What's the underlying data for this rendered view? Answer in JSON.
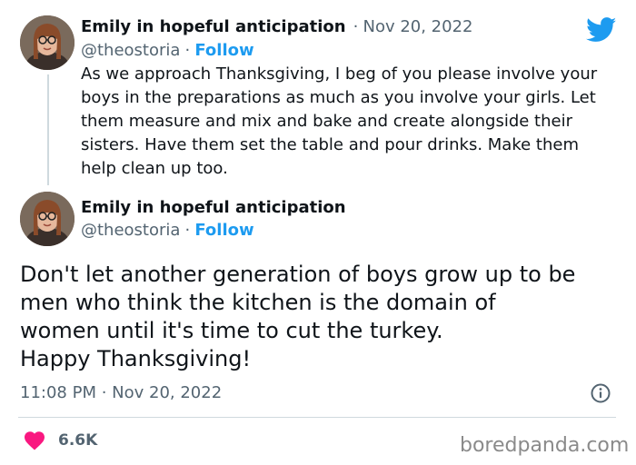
{
  "tweet1": {
    "author_name": "Emily in hopeful anticipation",
    "separator": "·",
    "date": "Nov 20, 2022",
    "handle": "@theostoria",
    "follow_label": "Follow",
    "text": "As we approach Thanksgiving, I beg of you please involve your boys in the preparations as much as you involve your girls. Let them measure and mix and bake and create alongside their sisters. Have them set the table and pour drinks. Make them help clean up too."
  },
  "tweet2": {
    "author_name": "Emily in hopeful anticipation",
    "handle": "@theostoria",
    "separator": "·",
    "follow_label": "Follow",
    "text_lines": [
      "Don't let another generation of boys grow up to be",
      "men who think the kitchen is the domain of",
      "women until it's time to cut the turkey.",
      "Happy Thanksgiving!"
    ],
    "time": "11:08 PM · Nov 20, 2022",
    "likes": "6.6K"
  },
  "icons": {
    "platform": "twitter-bird-icon",
    "info": "info-icon",
    "like": "heart-icon"
  },
  "colors": {
    "brand_blue": "#1d9bf0",
    "like_pink": "#f91880",
    "muted_text": "#536471"
  },
  "watermark": "boredpanda.com"
}
